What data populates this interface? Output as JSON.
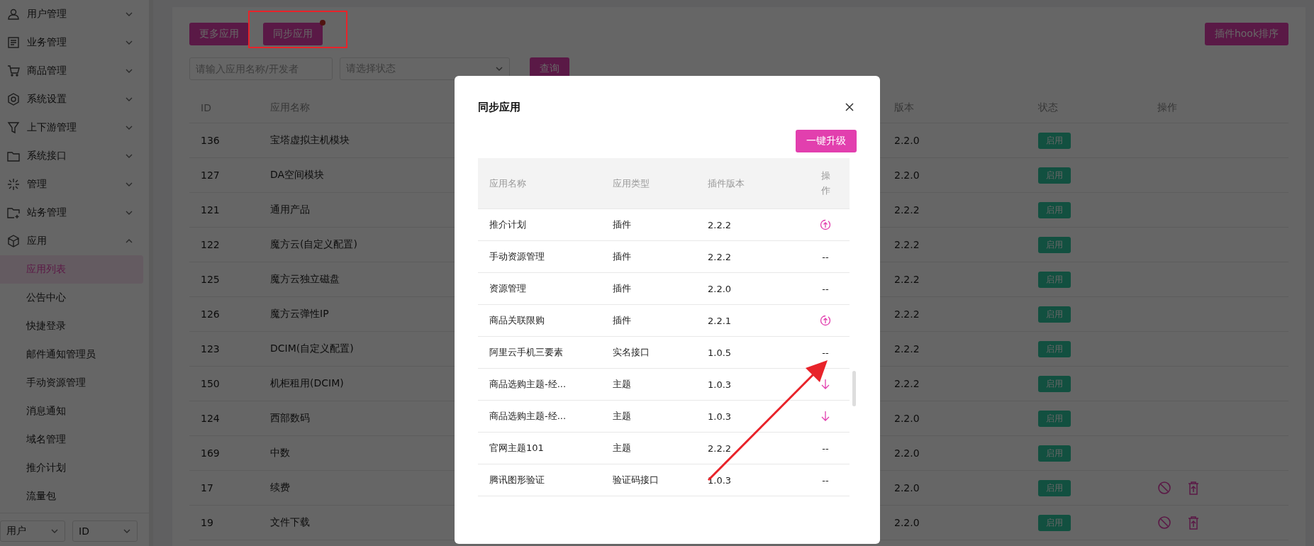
{
  "sidebar": {
    "items": [
      {
        "label": "用户管理",
        "expanded": false
      },
      {
        "label": "业务管理",
        "expanded": false
      },
      {
        "label": "商品管理",
        "expanded": false
      },
      {
        "label": "系统设置",
        "expanded": false
      },
      {
        "label": "上下游管理",
        "expanded": false
      },
      {
        "label": "系统接口",
        "expanded": false
      },
      {
        "label": "管理",
        "expanded": false
      },
      {
        "label": "站务管理",
        "expanded": false
      },
      {
        "label": "应用",
        "expanded": true,
        "children": [
          {
            "label": "应用列表",
            "selected": true
          },
          {
            "label": "公告中心",
            "selected": false
          },
          {
            "label": "快捷登录",
            "selected": false
          },
          {
            "label": "邮件通知管理员",
            "selected": false
          },
          {
            "label": "手动资源管理",
            "selected": false
          },
          {
            "label": "消息通知",
            "selected": false
          },
          {
            "label": "域名管理",
            "selected": false
          },
          {
            "label": "推介计划",
            "selected": false
          },
          {
            "label": "流量包",
            "selected": false
          }
        ]
      }
    ],
    "footer_selects": [
      "用户",
      "ID"
    ]
  },
  "toolbar": {
    "buttons": [
      {
        "label": "更多应用",
        "notice": false
      },
      {
        "label": "同步应用",
        "notice": true
      }
    ],
    "right_button": "插件hook排序"
  },
  "filters": {
    "search": {
      "placeholder": "请输入应用名称/开发者"
    },
    "status": {
      "placeholder": "请选择状态"
    },
    "query_button": "查询"
  },
  "table": {
    "columns": [
      "ID",
      "应用名称",
      "版本",
      "状态",
      "操作"
    ],
    "rows": [
      {
        "id": "136",
        "name": "宝塔虚拟主机模块",
        "version": "2.2.0",
        "status": "启用",
        "actions": false
      },
      {
        "id": "127",
        "name": "DA空间模块",
        "version": "2.2.0",
        "status": "启用",
        "actions": false
      },
      {
        "id": "121",
        "name": "通用产品",
        "version": "2.2.2",
        "status": "启用",
        "actions": false
      },
      {
        "id": "122",
        "name": "魔方云(自定义配置)",
        "version": "2.2.2",
        "status": "启用",
        "actions": false
      },
      {
        "id": "125",
        "name": "魔方云独立磁盘",
        "version": "2.2.2",
        "status": "启用",
        "actions": false
      },
      {
        "id": "126",
        "name": "魔方云弹性IP",
        "version": "2.2.2",
        "status": "启用",
        "actions": false
      },
      {
        "id": "123",
        "name": "DCIM(自定义配置)",
        "version": "2.2.2",
        "status": "启用",
        "actions": false
      },
      {
        "id": "150",
        "name": "机柜租用(DCIM)",
        "version": "2.2.2",
        "status": "启用",
        "actions": false
      },
      {
        "id": "124",
        "name": "西部数码",
        "version": "2.2.0",
        "status": "启用",
        "actions": false
      },
      {
        "id": "169",
        "name": "中数",
        "version": "2.2.0",
        "status": "启用",
        "actions": false
      },
      {
        "id": "17",
        "name": "续费",
        "version": "2.2.0",
        "status": "启用",
        "actions": true
      },
      {
        "id": "19",
        "name": "文件下载",
        "version": "2.2.0",
        "status": "启用",
        "actions": true
      }
    ]
  },
  "dialog": {
    "title": "同步应用",
    "upgrade_all_button": "一键升级",
    "columns": [
      "应用名称",
      "应用类型",
      "插件版本",
      "操作"
    ],
    "rows": [
      {
        "name": "推介计划",
        "type": "插件",
        "version": "2.2.2",
        "kind": "upgrade"
      },
      {
        "name": "手动资源管理",
        "type": "插件",
        "version": "2.2.2",
        "kind": "text",
        "action": "--"
      },
      {
        "name": "资源管理",
        "type": "插件",
        "version": "2.2.0",
        "kind": "text",
        "action": "--"
      },
      {
        "name": "商品关联限购",
        "type": "插件",
        "version": "2.2.1",
        "kind": "upgrade"
      },
      {
        "name": "阿里云手机三要素",
        "type": "实名接口",
        "version": "1.0.5",
        "kind": "text",
        "action": "--"
      },
      {
        "name": "商品选购主题-经...",
        "type": "主题",
        "version": "1.0.3",
        "kind": "download"
      },
      {
        "name": "商品选购主题-经...",
        "type": "主题",
        "version": "1.0.3",
        "kind": "download"
      },
      {
        "name": "官网主题101",
        "type": "主题",
        "version": "2.2.2",
        "kind": "text",
        "action": "--"
      },
      {
        "name": "腾讯图形验证",
        "type": "验证码接口",
        "version": "1.0.3",
        "kind": "text",
        "action": "--"
      }
    ]
  }
}
